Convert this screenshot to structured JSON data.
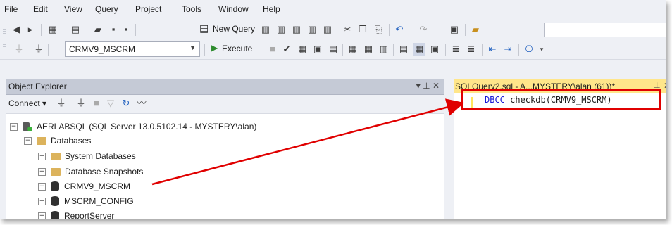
{
  "menu": [
    "File",
    "Edit",
    "View",
    "Query",
    "Project",
    "Tools",
    "Window",
    "Help"
  ],
  "toolbar1": {
    "new_query": "New Query"
  },
  "toolbar2": {
    "database": "CRMV9_MSCRM",
    "execute": "Execute"
  },
  "object_explorer": {
    "title": "Object Explorer",
    "controls": "▾ ⊥ ✕",
    "connect": "Connect",
    "tree": {
      "server": "AERLABSQL (SQL Server 13.0.5102.14 - MYSTERY\\alan)",
      "databases": "Databases",
      "children": [
        "System Databases",
        "Database Snapshots",
        "CRMV9_MSCRM",
        "MSCRM_CONFIG",
        "ReportServer"
      ]
    }
  },
  "editor": {
    "tab_title": "SQLQuery2.sql - A...MYSTERY\\alan (61))*",
    "keyword": "DBCC",
    "code_rest": " checkdb(CRMV9_MSCRM)"
  },
  "colors": {
    "highlight_red": "#e00000",
    "tab_yellow": "#ffe68a",
    "keyword_blue": "#1515d4"
  }
}
